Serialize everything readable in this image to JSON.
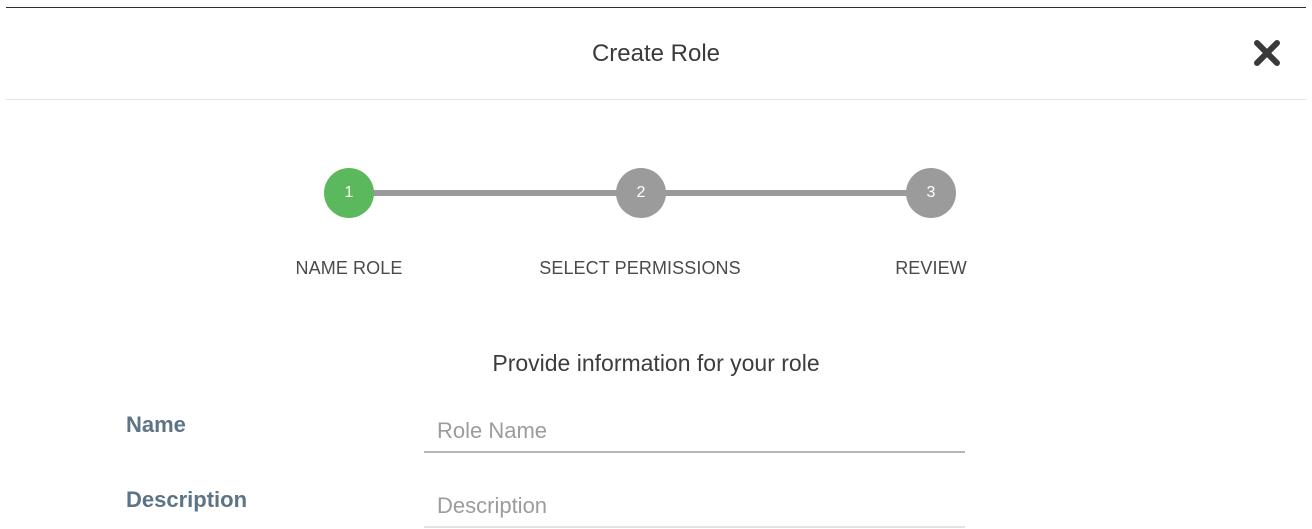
{
  "dialog": {
    "title": "Create Role",
    "close_icon": "close-icon"
  },
  "stepper": {
    "current_step": 1,
    "steps": [
      {
        "number": "1",
        "label": "NAME ROLE",
        "state": "active"
      },
      {
        "number": "2",
        "label": "SELECT PERMISSIONS",
        "state": "inactive"
      },
      {
        "number": "3",
        "label": "REVIEW",
        "state": "inactive"
      }
    ]
  },
  "form": {
    "subtitle": "Provide information for your role",
    "name": {
      "label": "Name",
      "value": "",
      "placeholder": "Role Name"
    },
    "description": {
      "label": "Description",
      "value": "",
      "placeholder": "Description"
    }
  },
  "colors": {
    "active_step": "#5cb85c",
    "inactive_step": "#9b9b9b",
    "field_label": "#5c7486"
  }
}
